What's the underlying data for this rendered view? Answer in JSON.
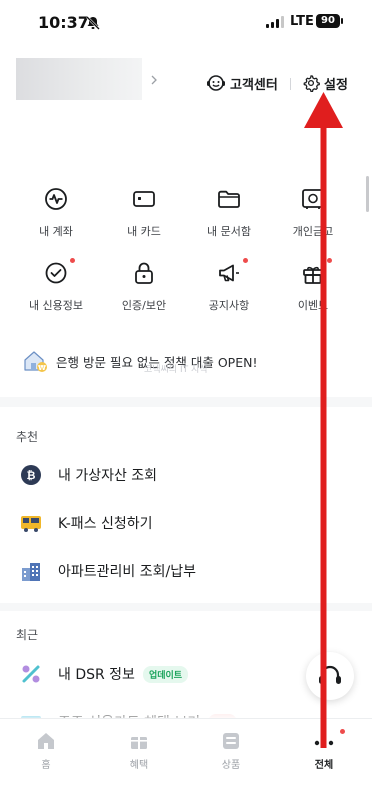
{
  "status_bar": {
    "time": "10:37",
    "network": "LTE",
    "battery": "90"
  },
  "header": {
    "support_label": "고객센터",
    "settings_label": "설정"
  },
  "grid": [
    {
      "label": "내 계좌",
      "icon": "account-pulse-icon",
      "dot": false
    },
    {
      "label": "내 카드",
      "icon": "card-icon",
      "dot": false
    },
    {
      "label": "내 문서함",
      "icon": "folder-icon",
      "dot": false
    },
    {
      "label": "개인금고",
      "icon": "safe-icon",
      "dot": false
    },
    {
      "label": "내 신용정보",
      "icon": "credit-check-icon",
      "dot": true
    },
    {
      "label": "인증/보안",
      "icon": "lock-icon",
      "dot": false
    },
    {
      "label": "공지사항",
      "icon": "megaphone-icon",
      "dot": true
    },
    {
      "label": "이벤트",
      "icon": "gift-icon",
      "dot": true
    }
  ],
  "banner": {
    "text": "은행 방문 필요 없는 정책 대출 OPEN!",
    "watermark": "코넥씨의 IT 지식"
  },
  "sections": {
    "recommended_title": "추천",
    "recent_title": "최근"
  },
  "recommended": [
    {
      "label": "내 가상자산 조회",
      "icon": "bitcoin-icon"
    },
    {
      "label": "K-패스 신청하기",
      "icon": "bus-icon"
    },
    {
      "label": "아파트관리비 조회/납부",
      "icon": "apartment-icon"
    }
  ],
  "recent": [
    {
      "label": "내 DSR 정보",
      "icon": "percent-icon",
      "tag": "업데이트"
    },
    {
      "label": "주주 신용카드 혜택 보기",
      "icon": "card-benefit-icon",
      "tag": "신규"
    }
  ],
  "bottom_nav": [
    {
      "label": "홈",
      "icon": "home-icon",
      "active": false
    },
    {
      "label": "혜택",
      "icon": "gift-box-icon",
      "active": false
    },
    {
      "label": "상품",
      "icon": "product-icon",
      "active": false
    },
    {
      "label": "전체",
      "icon": "more-dots-icon",
      "active": true
    }
  ],
  "colors": {
    "accent_red": "#e01e1e",
    "badge_red": "#ee4b4b",
    "tag_green": "#1aa35b"
  }
}
